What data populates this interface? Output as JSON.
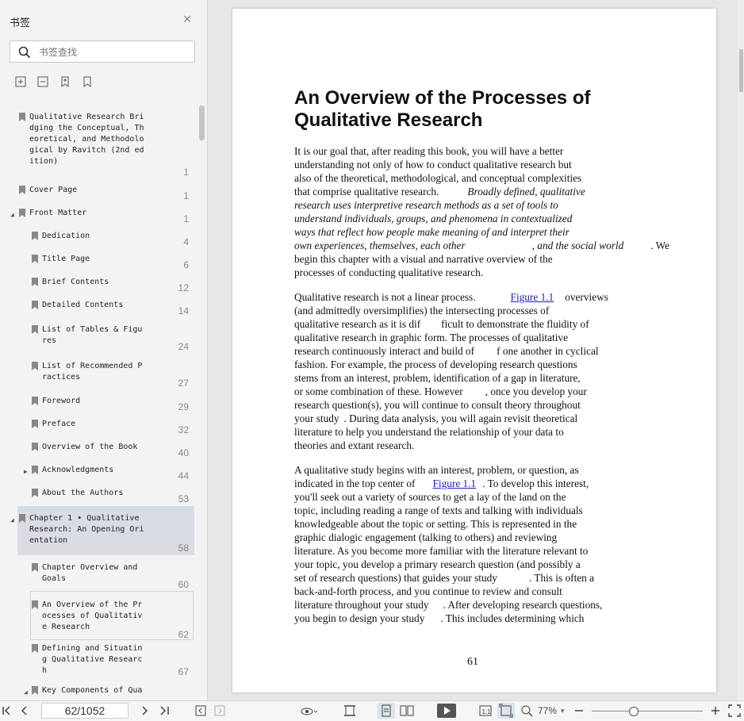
{
  "sidebar": {
    "title": "书签",
    "search_placeholder": "书签查找",
    "bookmarks": [
      {
        "lines": [
          "Qualitative Research Bri",
          "dging the Conceptual, Th",
          "eoretical, and Methodolo",
          "gical by Ravitch (2nd ed",
          "ition)"
        ],
        "page": "1"
      },
      {
        "lines": [
          "Cover Page"
        ],
        "page": "1"
      },
      {
        "lines": [
          "Front Matter"
        ],
        "page": "1"
      },
      {
        "lines": [
          "Dedication"
        ],
        "page": "4"
      },
      {
        "lines": [
          "Title Page"
        ],
        "page": "6"
      },
      {
        "lines": [
          "Brief Contents"
        ],
        "page": "12"
      },
      {
        "lines": [
          "Detailed Contents"
        ],
        "page": "14"
      },
      {
        "lines": [
          "List of Tables & Figu",
          "res"
        ],
        "page": "24"
      },
      {
        "lines": [
          "List of Recommended P",
          "ractices"
        ],
        "page": "27"
      },
      {
        "lines": [
          "Foreword"
        ],
        "page": "29"
      },
      {
        "lines": [
          "Preface"
        ],
        "page": "32"
      },
      {
        "lines": [
          "Overview of the Book"
        ],
        "page": "40"
      },
      {
        "lines": [
          "Acknowledgments"
        ],
        "page": "44"
      },
      {
        "lines": [
          "About the Authors"
        ],
        "page": "53"
      },
      {
        "lines": [
          "Chapter 1 • Qualitative",
          "Research: An Opening Ori",
          "entation"
        ],
        "page": "58"
      },
      {
        "lines": [
          "Chapter Overview and",
          "Goals"
        ],
        "page": "60"
      },
      {
        "lines": [
          "An Overview of the Pr",
          "ocesses of Qualitativ",
          "e Research"
        ],
        "page": "62"
      },
      {
        "lines": [
          "Defining and Situatin",
          "g Qualitative Researc",
          "h"
        ],
        "page": "67"
      },
      {
        "lines": [
          "Key Components of Qua"
        ],
        "page": ""
      }
    ]
  },
  "document": {
    "title_line1": "An Overview of the Processes of",
    "title_line2": "Qualitative Research",
    "p1": [
      "It is our goal that, after reading this book, you will have a better",
      "understanding not only of how to conduct qualitative research but",
      "also of the theoretical, methodological, and conceptual complexities",
      "that comprise qualitative research.",
      "Broadly defined, qualitative",
      "research uses interpretive research methods as a set of tools to",
      "understand individuals, groups, and phenomena in contextualized",
      "ways that reflect how people make meaning of and interpret their",
      "own experiences, themselves, each other",
      ", and the social world",
      ". We",
      "begin this chapter with a visual and narrative overview of the",
      "processes of conducting qualitative research."
    ],
    "p2": [
      "Qualitative research is not a linear process.",
      "Figure 1.1",
      "overviews",
      "(and admittedly oversimplifies) the intersecting processes of",
      "qualitative research as it is dif",
      "ficult to demonstrate the fluidity of",
      "qualitative research in graphic form. The processes of qualitative",
      "research continuously interact and build of",
      "f one another in cyclical",
      "fashion. For example, the process of developing research questions",
      "stems from an interest, problem, identification of a gap in literature,",
      "or some combination of these. However",
      ", once you develop your",
      "research question(s), you will continue to consult theory throughout",
      "your study",
      ". During data analysis, you will again revisit theoretical",
      "literature to help you understand the relationship of your data to",
      "theories and extant research."
    ],
    "p3": [
      "A qualitative study begins with an interest, problem, or question, as",
      "indicated in the top center of",
      "Figure 1.1",
      ". To develop this interest,",
      "you'll seek out a variety of sources to get a lay of the land on the",
      "topic, including reading a range of texts and talking with individuals",
      "knowledgeable about the topic or setting. This is represented in the",
      "graphic dialogic engagement (talking to others) and reviewing",
      "literature. As you become more familiar with the literature relevant to",
      "your topic, you develop a primary research question (and possibly a",
      "set of research questions) that guides your study",
      ". This is often a",
      "back-and-forth process, and you continue to review and consult",
      "literature throughout your study",
      ". After developing research questions,",
      "you begin to design your study",
      ". This includes determining which"
    ],
    "page_number": "61"
  },
  "bottombar": {
    "page_indicator": "62/1052",
    "zoom": "77%"
  },
  "colors": {
    "selected_bookmark": "#d9dde3",
    "link": "#2020c0"
  }
}
